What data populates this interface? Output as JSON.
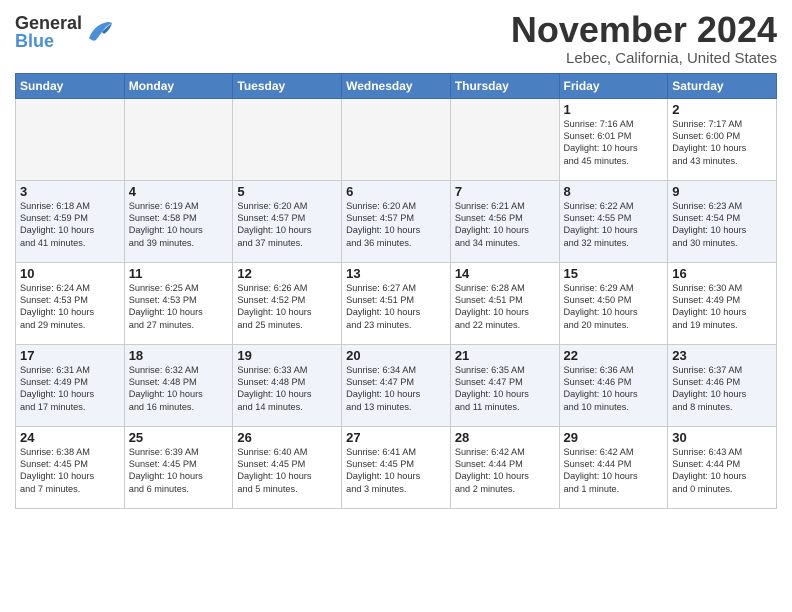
{
  "header": {
    "logo_general": "General",
    "logo_blue": "Blue",
    "month_title": "November 2024",
    "location": "Lebec, California, United States"
  },
  "weekdays": [
    "Sunday",
    "Monday",
    "Tuesday",
    "Wednesday",
    "Thursday",
    "Friday",
    "Saturday"
  ],
  "weeks": [
    [
      {
        "day": "",
        "info": ""
      },
      {
        "day": "",
        "info": ""
      },
      {
        "day": "",
        "info": ""
      },
      {
        "day": "",
        "info": ""
      },
      {
        "day": "",
        "info": ""
      },
      {
        "day": "1",
        "info": "Sunrise: 7:16 AM\nSunset: 6:01 PM\nDaylight: 10 hours\nand 45 minutes."
      },
      {
        "day": "2",
        "info": "Sunrise: 7:17 AM\nSunset: 6:00 PM\nDaylight: 10 hours\nand 43 minutes."
      }
    ],
    [
      {
        "day": "3",
        "info": "Sunrise: 6:18 AM\nSunset: 4:59 PM\nDaylight: 10 hours\nand 41 minutes."
      },
      {
        "day": "4",
        "info": "Sunrise: 6:19 AM\nSunset: 4:58 PM\nDaylight: 10 hours\nand 39 minutes."
      },
      {
        "day": "5",
        "info": "Sunrise: 6:20 AM\nSunset: 4:57 PM\nDaylight: 10 hours\nand 37 minutes."
      },
      {
        "day": "6",
        "info": "Sunrise: 6:20 AM\nSunset: 4:57 PM\nDaylight: 10 hours\nand 36 minutes."
      },
      {
        "day": "7",
        "info": "Sunrise: 6:21 AM\nSunset: 4:56 PM\nDaylight: 10 hours\nand 34 minutes."
      },
      {
        "day": "8",
        "info": "Sunrise: 6:22 AM\nSunset: 4:55 PM\nDaylight: 10 hours\nand 32 minutes."
      },
      {
        "day": "9",
        "info": "Sunrise: 6:23 AM\nSunset: 4:54 PM\nDaylight: 10 hours\nand 30 minutes."
      }
    ],
    [
      {
        "day": "10",
        "info": "Sunrise: 6:24 AM\nSunset: 4:53 PM\nDaylight: 10 hours\nand 29 minutes."
      },
      {
        "day": "11",
        "info": "Sunrise: 6:25 AM\nSunset: 4:53 PM\nDaylight: 10 hours\nand 27 minutes."
      },
      {
        "day": "12",
        "info": "Sunrise: 6:26 AM\nSunset: 4:52 PM\nDaylight: 10 hours\nand 25 minutes."
      },
      {
        "day": "13",
        "info": "Sunrise: 6:27 AM\nSunset: 4:51 PM\nDaylight: 10 hours\nand 23 minutes."
      },
      {
        "day": "14",
        "info": "Sunrise: 6:28 AM\nSunset: 4:51 PM\nDaylight: 10 hours\nand 22 minutes."
      },
      {
        "day": "15",
        "info": "Sunrise: 6:29 AM\nSunset: 4:50 PM\nDaylight: 10 hours\nand 20 minutes."
      },
      {
        "day": "16",
        "info": "Sunrise: 6:30 AM\nSunset: 4:49 PM\nDaylight: 10 hours\nand 19 minutes."
      }
    ],
    [
      {
        "day": "17",
        "info": "Sunrise: 6:31 AM\nSunset: 4:49 PM\nDaylight: 10 hours\nand 17 minutes."
      },
      {
        "day": "18",
        "info": "Sunrise: 6:32 AM\nSunset: 4:48 PM\nDaylight: 10 hours\nand 16 minutes."
      },
      {
        "day": "19",
        "info": "Sunrise: 6:33 AM\nSunset: 4:48 PM\nDaylight: 10 hours\nand 14 minutes."
      },
      {
        "day": "20",
        "info": "Sunrise: 6:34 AM\nSunset: 4:47 PM\nDaylight: 10 hours\nand 13 minutes."
      },
      {
        "day": "21",
        "info": "Sunrise: 6:35 AM\nSunset: 4:47 PM\nDaylight: 10 hours\nand 11 minutes."
      },
      {
        "day": "22",
        "info": "Sunrise: 6:36 AM\nSunset: 4:46 PM\nDaylight: 10 hours\nand 10 minutes."
      },
      {
        "day": "23",
        "info": "Sunrise: 6:37 AM\nSunset: 4:46 PM\nDaylight: 10 hours\nand 8 minutes."
      }
    ],
    [
      {
        "day": "24",
        "info": "Sunrise: 6:38 AM\nSunset: 4:45 PM\nDaylight: 10 hours\nand 7 minutes."
      },
      {
        "day": "25",
        "info": "Sunrise: 6:39 AM\nSunset: 4:45 PM\nDaylight: 10 hours\nand 6 minutes."
      },
      {
        "day": "26",
        "info": "Sunrise: 6:40 AM\nSunset: 4:45 PM\nDaylight: 10 hours\nand 5 minutes."
      },
      {
        "day": "27",
        "info": "Sunrise: 6:41 AM\nSunset: 4:45 PM\nDaylight: 10 hours\nand 3 minutes."
      },
      {
        "day": "28",
        "info": "Sunrise: 6:42 AM\nSunset: 4:44 PM\nDaylight: 10 hours\nand 2 minutes."
      },
      {
        "day": "29",
        "info": "Sunrise: 6:42 AM\nSunset: 4:44 PM\nDaylight: 10 hours\nand 1 minute."
      },
      {
        "day": "30",
        "info": "Sunrise: 6:43 AM\nSunset: 4:44 PM\nDaylight: 10 hours\nand 0 minutes."
      }
    ]
  ]
}
